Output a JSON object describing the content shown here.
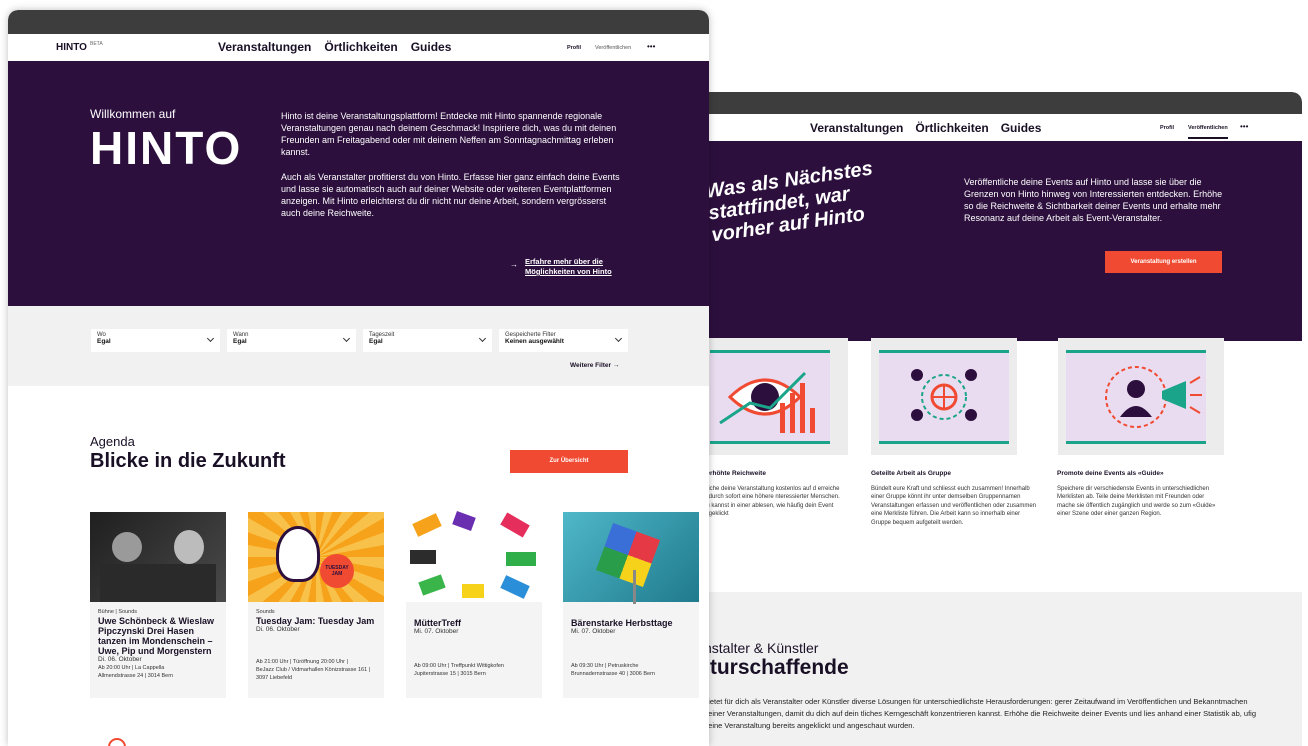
{
  "front": {
    "logo": "HINTO",
    "beta": "BETA",
    "nav": [
      "Veranstaltungen",
      "Örtlichkeiten",
      "Guides"
    ],
    "right_links": [
      "Profil",
      "Veröffentlichen"
    ],
    "more": "•••",
    "hero": {
      "welcome": "Willkommen auf",
      "big_logo": "HINTO",
      "para1": "Hinto ist deine Veranstaltungsplattform! Entdecke mit Hinto spannende regionale Veranstaltungen genau nach deinem Geschmack! Inspiriere dich, was du mit deinen Freunden am Freitagabend oder mit deinem Neffen am Sonntagnachmittag erleben kannst.",
      "para2": "Auch als Veranstalter profitierst du von Hinto. Erfasse hier ganz einfach deine Events und lasse sie automatisch auch auf deiner Website oder weiteren Eventplattformen anzeigen. Mit Hinto erleichterst du dir nicht nur deine Arbeit, sondern vergrösserst auch deine Reichweite.",
      "cta_line1": "Erfahre mehr über die",
      "cta_line2": "Möglichkeiten von Hinto"
    },
    "filters": [
      {
        "label": "Wo",
        "value": "Egal"
      },
      {
        "label": "Wann",
        "value": "Egal"
      },
      {
        "label": "Tageszeit",
        "value": "Egal"
      },
      {
        "label": "Gespeicherte Filter",
        "value": "Keinen ausgewählt"
      }
    ],
    "more_filters": "Weitere Filter",
    "agenda": {
      "kicker": "Agenda",
      "title": "Blicke in die Zukunft",
      "button": "Zur Übersicht"
    },
    "events": [
      {
        "category": "Bühne | Sounds",
        "title": "Uwe Schönbeck & Wieslaw Pipczynski Drei Hasen tanzen im Mondenschein – Uwe, Pip und Morgenstern",
        "date": "Di. 06. Oktober",
        "time": "Ab 20:00 Uhr | La Cappella",
        "address": "Allmendstrasse 24 | 3014 Bern",
        "image": "photo-two-men"
      },
      {
        "category": "Sounds",
        "title": "Tuesday Jam: Tuesday Jam",
        "date": "Di. 06. Oktober",
        "time": "Ab 21:00 Uhr | Türöffnung 20:00 Uhr |",
        "address": "BeJazz Club / Vidmarhallen Könizstrasse 161 | 3097 Liebefeld",
        "image": "illustration-tuesday-jam",
        "badge": "TUESDAY JAM"
      },
      {
        "category": "",
        "title": "MütterTreff",
        "date": "Mi. 07. Oktober",
        "time": "Ab 09:00 Uhr | Treffpunkt Wittigkofen",
        "address": "Jupiterstrasse 15 | 3015 Bern",
        "image": "illustration-colorful-hands"
      },
      {
        "category": "",
        "title": "Bärenstarke Herbsttage",
        "date": "Mi. 07. Oktober",
        "time": "Ab 09:30 Uhr | Petruskirche",
        "address": "Brunnadernstrasse 40 | 3006 Bern",
        "image": "photo-pinwheel"
      }
    ]
  },
  "back": {
    "nav": [
      "Veranstaltungen",
      "Örtlichkeiten",
      "Guides"
    ],
    "right_links": [
      "Profil",
      "Veröffentlichen"
    ],
    "more": "•••",
    "slogan": "Was als Nächstes stattfindet, war vorher auf Hinto",
    "hero_text": "Veröffentliche deine Events auf Hinto und lasse sie über die Grenzen von Hinto hinweg von Interessierten entdecken. Erhöhe so die Reichweite & Sichtbarkeit deiner Events und erhalte mehr Resonanz auf deine Arbeit als Event-Veranstalter.",
    "button": "Veranstaltung erstellen",
    "features": [
      {
        "title": "r erhöhte Reichweite",
        "text": "ntliche deine Veranstaltung kostenlos auf d erreiche dadurch sofort eine höhere nteressierter Menschen. Du kannst in einer ablesen, wie häufig dein Event angeklickt",
        "icon": "eye-chart-icon"
      },
      {
        "title": "Geteilte Arbeit als Gruppe",
        "text": "Bündelt eure Kraft und schliesst euch zusammen! Innerhalb einer Gruppe könnt ihr unter demselben Gruppennamen Veranstaltungen erfassen und veröffentlichen oder zusammen eine Merkliste führen. Die Arbeit kann so innerhalb einer Gruppe bequem aufgeteilt werden.",
        "icon": "group-globe-icon"
      },
      {
        "title": "Promote deine Events als «Guide»",
        "text": "Speichere dir verschiedenste Events in unterschiedlichen Merklisten ab. Teile deine Merklisten mit Freunden oder mache sie öffentlich zugänglich und werde so zum «Guide» einer Szene oder einer ganzen Region.",
        "icon": "megaphone-person-icon"
      }
    ],
    "section_kicker": "nstalter & Künstler",
    "section_title": "lturschaffende",
    "section_text": "bietet für dich als Veranstalter oder Künstler diverse Lösungen für unterschiedlichste Herausforderungen: gerer Zeitaufwand im Veröffentlichen und Bekanntmachen deiner Veranstaltungen, damit du dich auf dein tliches Kerngeschäft konzentrieren kannst. Erhöhe die Reichweite deiner Events und lies anhand einer Statistik ab, ufig deine Veranstaltung bereits angeklickt und angeschaut wurden."
  },
  "colors": {
    "purple": "#2c0f3d",
    "red": "#f04b32",
    "grey": "#f1f1f1",
    "teal": "#1aa58a",
    "lilac": "#eadcf0"
  }
}
